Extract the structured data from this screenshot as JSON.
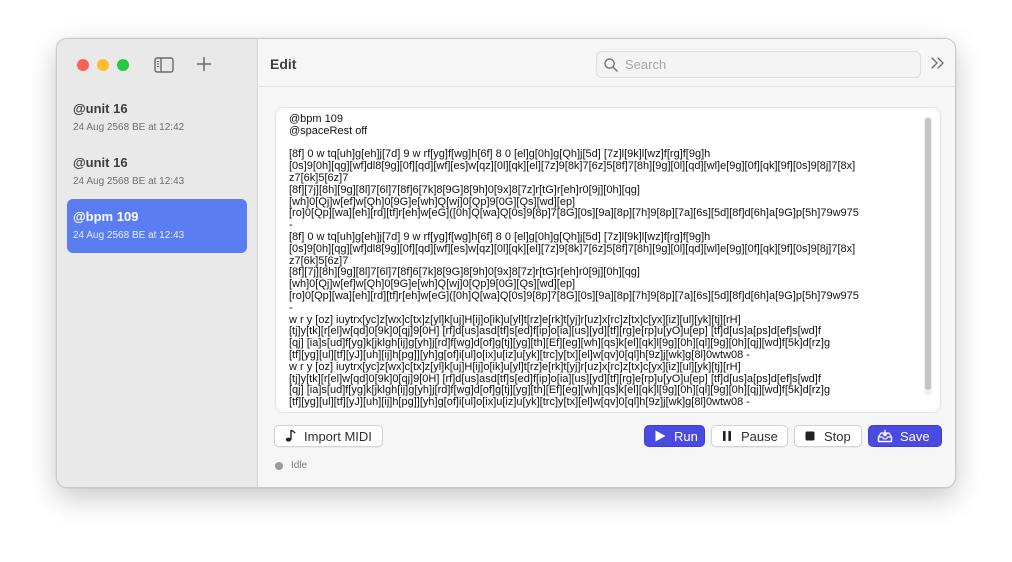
{
  "colors": {
    "close": "#ff5f57",
    "minimize": "#febc2e",
    "zoom": "#28c840",
    "accent": "#5a7ef2",
    "primary_button": "#4a49e2",
    "status_idle": "#9b9b9b"
  },
  "sidebar": {
    "toggle_icon": "sidebar-icon",
    "new_icon": "plus-icon",
    "items": [
      {
        "title": "@unit 16",
        "date": "24 Aug 2568 BE at 12:42",
        "selected": false
      },
      {
        "title": "@unit 16",
        "date": "24 Aug 2568 BE at 12:43",
        "selected": false
      },
      {
        "title": "@bpm 109",
        "date": "24 Aug 2568 BE at 12:43",
        "selected": true
      }
    ]
  },
  "toolbar": {
    "title": "Edit",
    "search_placeholder": "Search",
    "search_value": "",
    "more_icon": "chevron-double-right-icon"
  },
  "editor": {
    "content": "@bpm 109\n@spaceRest off\n\n[8f] 0 w tq[uh]g[eh]j[7d] 9 w rf[yg]f[wg]h[6f] 8 0 [el]g[0h]g[Qh]j[5d] [7z]l[9k]l[wz]f[rg]f[9g]h\n[0s]9[0h][qg][wf]dl8[9g][0f][qd][wf][es]w[qz][0l][qk][el][7z]9[8k]7[6z]5[8f]7[8h][9g][0l][qd][wl]e[9g][0f][qk][9f][0s]9[8j]7[8x]\nz7[6k]5[6z]7\n[8f][7j][8h][9g][8l]7[6l]7[8f]6[7k]8[9G]8[9h]0[9x]8[7z]r[tG]r[eh]r0[9j][0h][qg]\n[wh]0[Qj]w[ef]w[Qh]0[9G]e[wh]Q[wj]0[Qp]9[0G][Qs][wd][ep]\n[ro]0[Qp][wa][eh][rd][tf]r[eh]w[eG]([0h]Q[wa]Q[0s]9[8p]7[8G][0s][9a][8p][7h]9[8p][7a][6s][5d][8f]d[6h]a[9G]p[5h]79w975\n-\n[8f] 0 w tq[uh]g[eh]j[7d] 9 w rf[yg]f[wg]h[6f] 8 0 [el]g[0h]g[Qh]j[5d] [7z]l[9k]l[wz]f[rg]f[9g]h\n[0s]9[0h][qg][wf]dl8[9g][0f][qd][wf][es]w[qz][0l][qk][el][7z]9[8k]7[6z]5[8f]7[8h][9g][0l][qd][wl]e[9g][0f][qk][9f][0s]9[8j]7[8x]\nz7[6k]5[6z]7\n[8f][7j][8h][9g][8l]7[6l]7[8f]6[7k]8[9G]8[9h]0[9x]8[7z]r[tG]r[eh]r0[9j][0h][qg]\n[wh]0[Qj]w[ef]w[Qh]0[9G]e[wh]Q[wj]0[Qp]9[0G][Qs][wd][ep]\n[ro]0[Qp][wa][eh][rd][tf]r[eh]w[eG]([0h]Q[wa]Q[0s]9[8p]7[8G][0s][9a][8p][7h]9[8p][7a][6s][5d][8f]d[6h]a[9G]p[5h]79w975\n-\nw r y [oz] iuytrx[yc]z[wx]c[tx]z[yl]k[uj]H[ij]o[ik]u[yl]t[rz]e[rk]t[yj]r[uz]x[rc]z[tx]c[yx][iz][ul][yk][tj][rH]\n[tj]y[tk][r[el]w[qd]0[9k]0[qj]9[0H] [rf]d[us]asd[tf]s[ed]f[ip]o[ia][us][yd][tf][rg]e[rp]u[yO]u[ep] [tf]d[us]a[ps]d[ef]s[wd]f\n[qj] [ia]s[ud]f[yg]k[jklgh[ij]g[yh]j[rd]f[wg]d[of]g[tj][yg][th][Ef][eg][wh][qs]k[el][qk]l[9g][0h][ql][9g][0h][qj][wd]f[5k]d[rz]g\n[tf][yg][ul][tf][yJ][uh][ij]h[pg]][yh]g[of]i[ul]o[ix]u[iz]u[yk][trc]y[tx][el]w[qv]0[ql]h[9z]j[wk]g[8l]0wtw08 -\nw r y [oz] iuytrx[yc]z[wx]c[tx]z[yl]k[uj]H[ij]o[ik]u[yl]t[rz]e[rk]t[yj]r[uz]x[rc]z[tx]c[yx][iz][ul][yk][tj][rH]\n[tj]y[tk][r[el]w[qd]0[9k]0[qj]9[0H] [rf]d[us]asd[tf]s[ed]f[ip]o[ia][us][yd][tf][rg]e[rp]u[yO]u[ep] [tf]d[us]a[ps]d[ef]s[wd]f\n[qj] [ia]s[ud]f[yg]k[jklgh[ij]g[yh]j[rd]f[wg]d[of]g[tj][yg][th][Ef][eg][wh][qs]k[el][qk]l[9g][0h][ql][9g][0h][qj][wd]f[5k]d[rz]g\n[tf][yg][ul][tf][yJ][uh][ij]h[pg]][yh]g[of]i[ul]o[ix]u[iz]u[yk][trc]y[tx][el]w[qv]0[ql]h[9z]j[wk]g[8l]0wtw08 -"
  },
  "actions": {
    "import_label": "Import MIDI",
    "import_icon": "music-note-icon",
    "run_label": "Run",
    "run_icon": "play-icon",
    "pause_label": "Pause",
    "pause_icon": "pause-icon",
    "stop_label": "Stop",
    "stop_icon": "stop-icon",
    "save_label": "Save",
    "save_icon": "save-tray-icon"
  },
  "status": {
    "text": "Idle"
  }
}
